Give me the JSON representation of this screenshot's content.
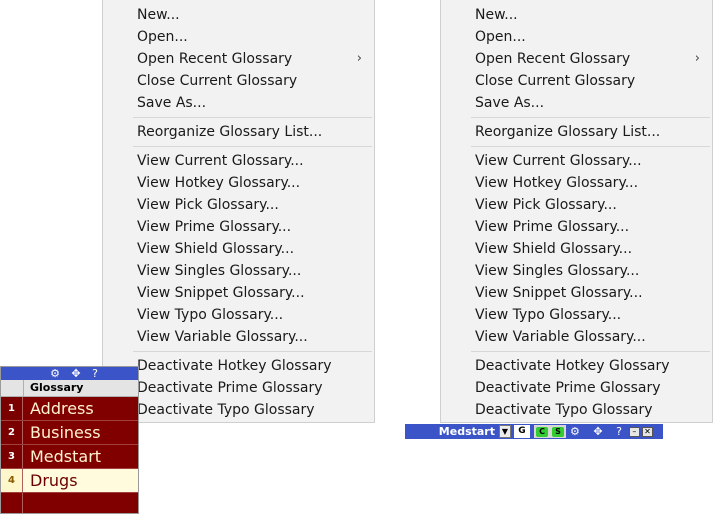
{
  "menu": {
    "items": [
      {
        "label": "New...",
        "submenu": false
      },
      {
        "label": "Open...",
        "submenu": false
      },
      {
        "label": "Open Recent Glossary",
        "submenu": true
      },
      {
        "label": "Close Current Glossary",
        "submenu": false
      },
      {
        "label": "Save As...",
        "submenu": false
      },
      {
        "separator": true
      },
      {
        "label": "Reorganize Glossary List...",
        "submenu": false
      },
      {
        "separator": true
      },
      {
        "label": "View Current Glossary...",
        "submenu": false
      },
      {
        "label": "View Hotkey Glossary...",
        "submenu": false
      },
      {
        "label": "View Pick Glossary...",
        "submenu": false
      },
      {
        "label": "View Prime Glossary...",
        "submenu": false
      },
      {
        "label": "View Shield Glossary...",
        "submenu": false
      },
      {
        "label": "View Singles Glossary...",
        "submenu": false
      },
      {
        "label": "View Snippet Glossary...",
        "submenu": false
      },
      {
        "label": "View Typo Glossary...",
        "submenu": false
      },
      {
        "label": "View Variable Glossary...",
        "submenu": false
      },
      {
        "separator": true
      },
      {
        "label": "Deactivate Hotkey Glossary",
        "submenu": false
      },
      {
        "label": "Deactivate Prime Glossary",
        "submenu": false
      },
      {
        "label": "Deactivate Typo Glossary",
        "submenu": false
      }
    ],
    "submenu_arrow": "›"
  },
  "glossary_panel": {
    "toolbar_icons": "⚙ ✥ ?",
    "column_header": "Glossary",
    "rows": [
      {
        "num": "1",
        "name": "Address",
        "selected": false
      },
      {
        "num": "2",
        "name": "Business",
        "selected": false
      },
      {
        "num": "3",
        "name": "Medstart",
        "selected": false
      },
      {
        "num": "4",
        "name": "Drugs",
        "selected": true
      }
    ]
  },
  "medstart_bar": {
    "name": "Medstart",
    "dropdown": "▼",
    "g_label": "G",
    "c_label": "C",
    "s_label": "S",
    "icons": "⚙ ✥ ?",
    "minimize": "–",
    "close": "✕"
  },
  "colors": {
    "menu_bg": "#f2f2f2",
    "toolbar_blue": "#3b55c8",
    "row_maroon": "#800000",
    "row_selected": "#fffbdc"
  }
}
